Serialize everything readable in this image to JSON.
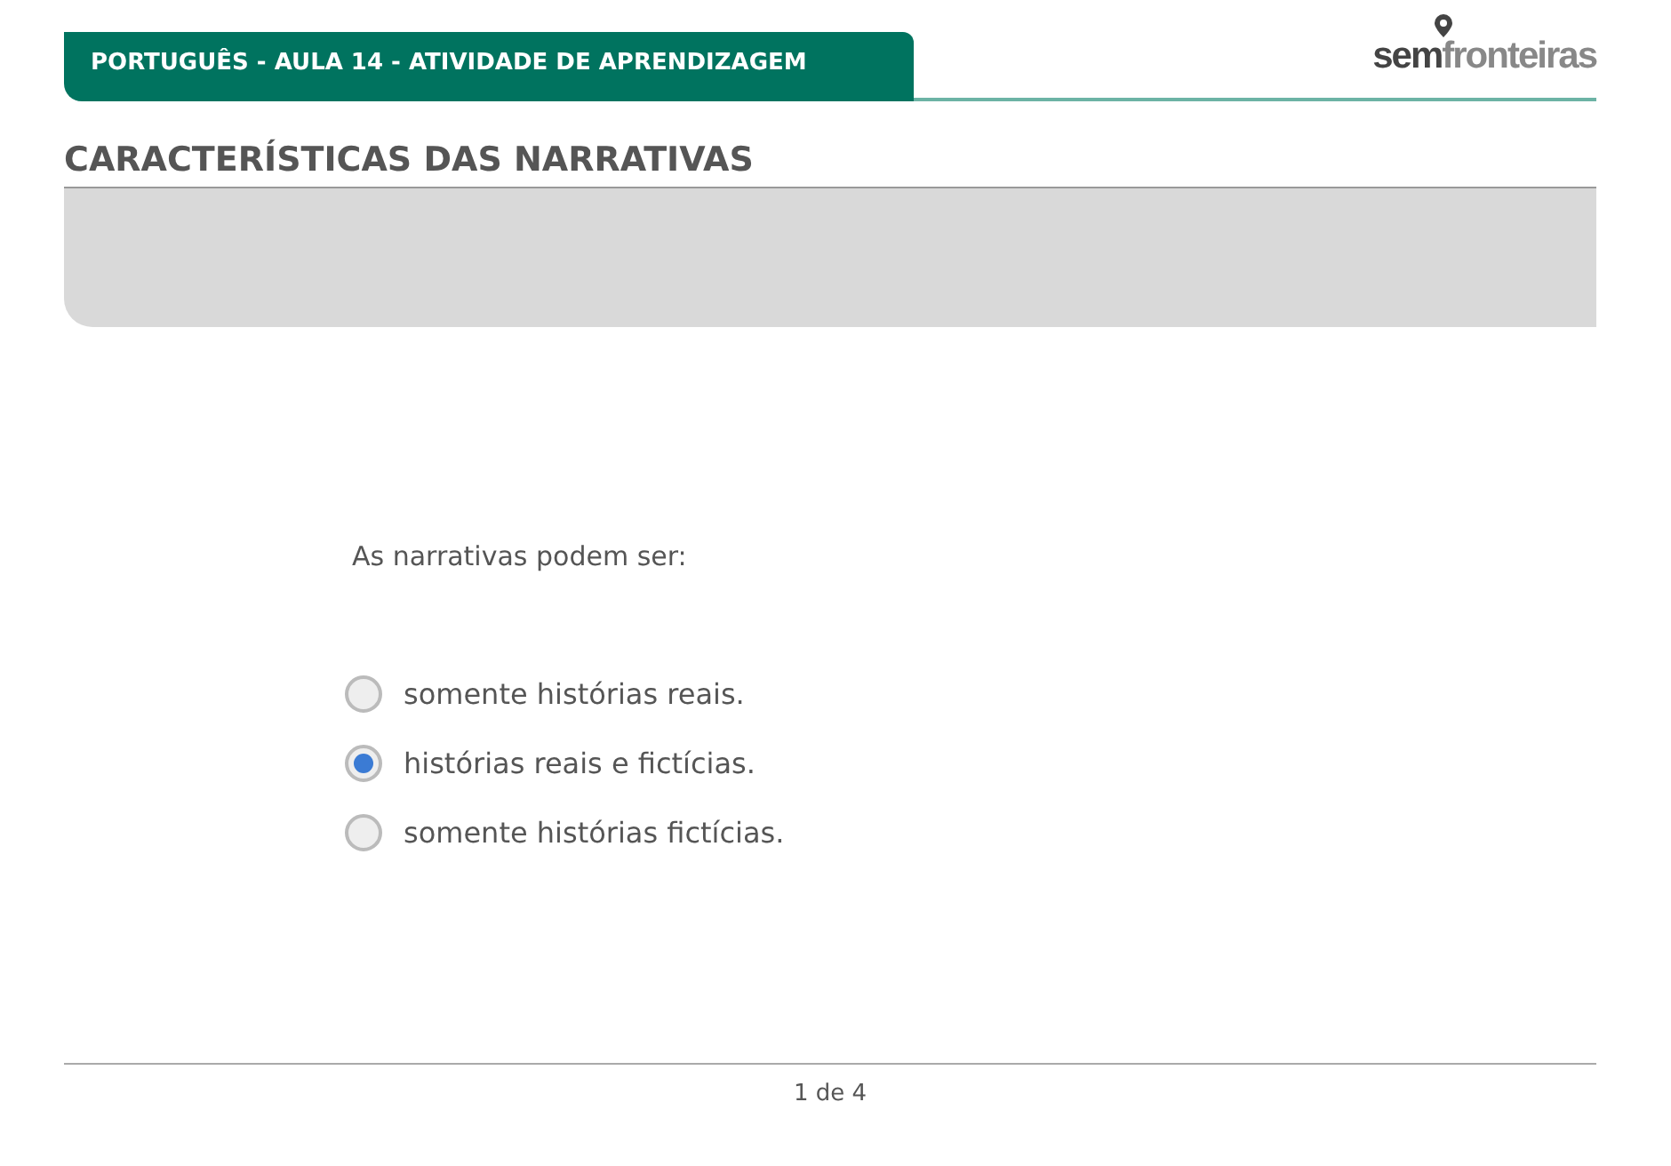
{
  "header": {
    "title": "PORTUGUÊS - AULA 14 - ATIVIDADE DE APRENDIZAGEM",
    "logo": "**sem**fronteiras"
  },
  "section_title": "CARACTERÍSTICAS DAS NARRATIVAS",
  "question": "As narrativas podem ser:",
  "options": [
    {
      "label": "somente histórias reais.",
      "selected": false
    },
    {
      "label": "histórias reais e fictícias.",
      "selected": true
    },
    {
      "label": "somente histórias fictícias.",
      "selected": false
    }
  ],
  "pagination": "1 de 4"
}
